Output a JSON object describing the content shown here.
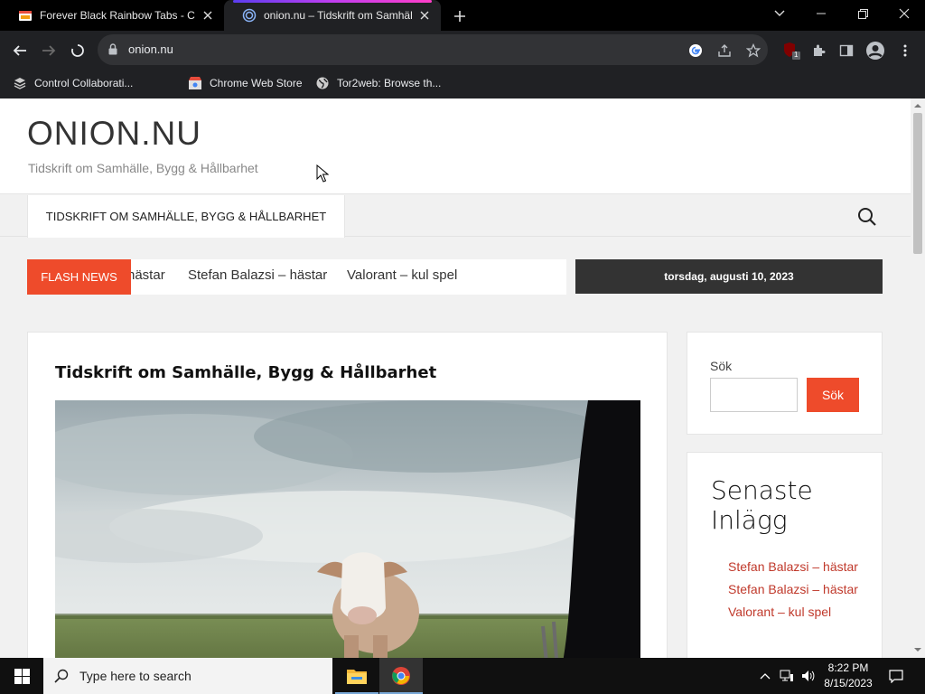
{
  "browser": {
    "tabs": [
      {
        "title": "Forever Black Rainbow Tabs - Chrome Web Store",
        "active": false
      },
      {
        "title": "onion.nu – Tidskrift om Samhälle, Bygg & Hållbarhet",
        "active": true
      }
    ],
    "url": "onion.nu",
    "bookmarks": [
      {
        "label": "Control Collaborati..."
      },
      {
        "label": "Chrome Web Store"
      },
      {
        "label": "Tor2web: Browse th..."
      }
    ],
    "extension_badge": "1"
  },
  "site": {
    "title": "ONION.NU",
    "tagline": "Tidskrift om Samhälle, Bygg & Hållbarhet",
    "nav": {
      "item": "TIDSKRIFT OM SAMHÄLLE, BYGG & HÅLLBARHET"
    },
    "flash": {
      "label": "FLASH NEWS",
      "items": [
        "hästar",
        "Stefan Balazsi – hästar",
        "Valorant – kul spel"
      ]
    },
    "date": "torsdag, augusti 10, 2023"
  },
  "article": {
    "title": "Tidskrift om Samhälle, Bygg & Hållbarhet"
  },
  "sidebar": {
    "search": {
      "label": "Sök",
      "button": "Sök",
      "value": ""
    },
    "recent": {
      "title": "Senaste Inlägg",
      "items": [
        "Stefan Balazsi – hästar",
        "Stefan Balazsi – hästar",
        "Valorant – kul spel"
      ]
    }
  },
  "taskbar": {
    "search_placeholder": "Type here to search",
    "time": "8:22 PM",
    "date": "8/15/2023"
  },
  "colors": {
    "accent": "#ee4b2b",
    "link": "#c0392b",
    "dark_box": "#333333"
  }
}
